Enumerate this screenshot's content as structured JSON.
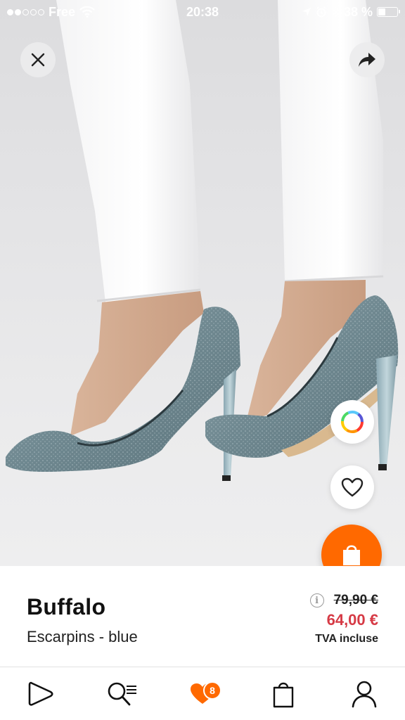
{
  "status_bar": {
    "carrier": "Free",
    "time": "20:38",
    "battery": "38 %"
  },
  "product": {
    "brand": "Buffalo",
    "name": "Escarpins - blue",
    "old_price": "79,90 €",
    "new_price": "64,00 €",
    "tax_note": "TVA incluse",
    "info_symbol": "i"
  },
  "tab_bar": {
    "wishlist_count": "8"
  },
  "colors": {
    "accent": "#ff6900",
    "sale_price": "#d63a45"
  },
  "icons": {
    "close": "close-icon",
    "share": "share-icon",
    "colors": "color-wheel-icon",
    "favorite": "heart-icon",
    "cart": "shopping-bag-icon"
  }
}
